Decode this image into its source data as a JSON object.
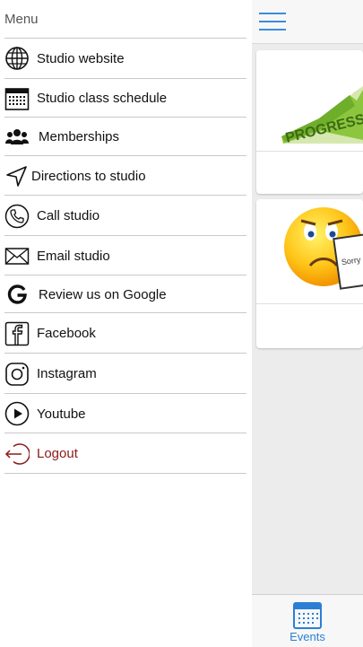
{
  "menu": {
    "title": "Menu",
    "items": [
      {
        "label": "Studio website",
        "icon": "globe-icon"
      },
      {
        "label": "Studio class schedule",
        "icon": "calendar-icon"
      },
      {
        "label": "Memberships",
        "icon": "people-icon"
      },
      {
        "label": "Directions to studio",
        "icon": "navigation-arrow-icon"
      },
      {
        "label": "Call studio",
        "icon": "phone-icon"
      },
      {
        "label": "Email studio",
        "icon": "envelope-icon"
      },
      {
        "label": "Review us on Google",
        "icon": "google-icon"
      },
      {
        "label": "Facebook",
        "icon": "facebook-icon"
      },
      {
        "label": "Instagram",
        "icon": "instagram-icon"
      },
      {
        "label": "Youtube",
        "icon": "youtube-play-icon"
      },
      {
        "label": "Logout",
        "icon": "logout-icon"
      }
    ]
  },
  "main": {
    "cards": [
      {
        "image_text": "PROGRESS",
        "image": "progress-graphic"
      },
      {
        "image_text": "Sorry CLOSED",
        "image": "sad-emoji-closed-sign"
      }
    ]
  },
  "tabbar": {
    "tabs": [
      {
        "label": "Events",
        "icon": "calendar-icon",
        "active": true
      }
    ]
  },
  "colors": {
    "accent": "#2a7fd4",
    "logout": "#8b1a1a"
  }
}
